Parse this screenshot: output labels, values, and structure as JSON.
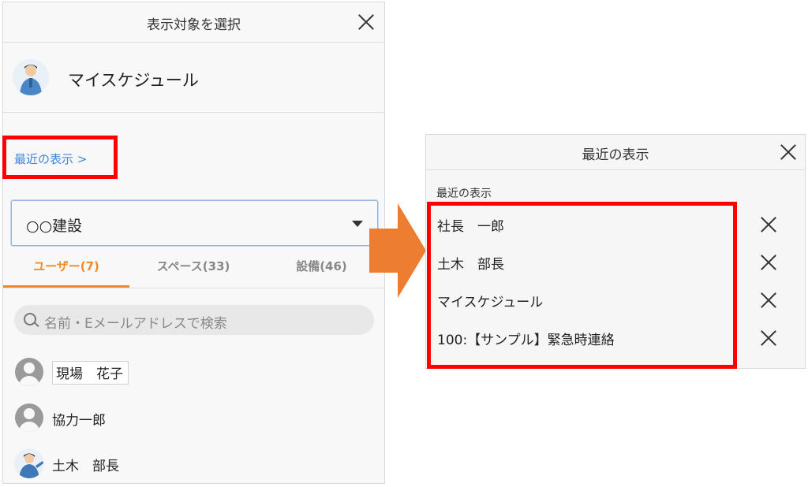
{
  "left_panel": {
    "title": "表示対象を選択",
    "my_schedule": "マイスケジュール",
    "recent_link": "最近の表示 >",
    "company_select": {
      "value": "○○建設"
    },
    "tabs": [
      {
        "label": "ユーザー(7)",
        "active": true
      },
      {
        "label": "スペース(33)",
        "active": false
      },
      {
        "label": "設備(46)",
        "active": false
      }
    ],
    "search": {
      "placeholder": "名前・Eメールアドレスで検索"
    },
    "users": [
      {
        "name": "現場　花子",
        "avatar": "generic-user-icon"
      },
      {
        "name": "協力一郎",
        "avatar": "generic-user-icon"
      },
      {
        "name": "土木　部長",
        "avatar": "photo"
      }
    ]
  },
  "right_panel": {
    "title": "最近の表示",
    "section_label": "最近の表示",
    "items": [
      {
        "label": "社長　一郎"
      },
      {
        "label": "土木　部長"
      },
      {
        "label": "マイスケジュール"
      },
      {
        "label": "100:【サンプル】緊急時連絡"
      }
    ]
  },
  "colors": {
    "highlight": "#ff0000",
    "arrow": "#ed7d31",
    "active_tab": "#f08a24",
    "link": "#3a86e0"
  },
  "icons": [
    "close-icon",
    "search-icon",
    "dropdown-caret-icon",
    "user-icon",
    "arrow-right-icon"
  ]
}
